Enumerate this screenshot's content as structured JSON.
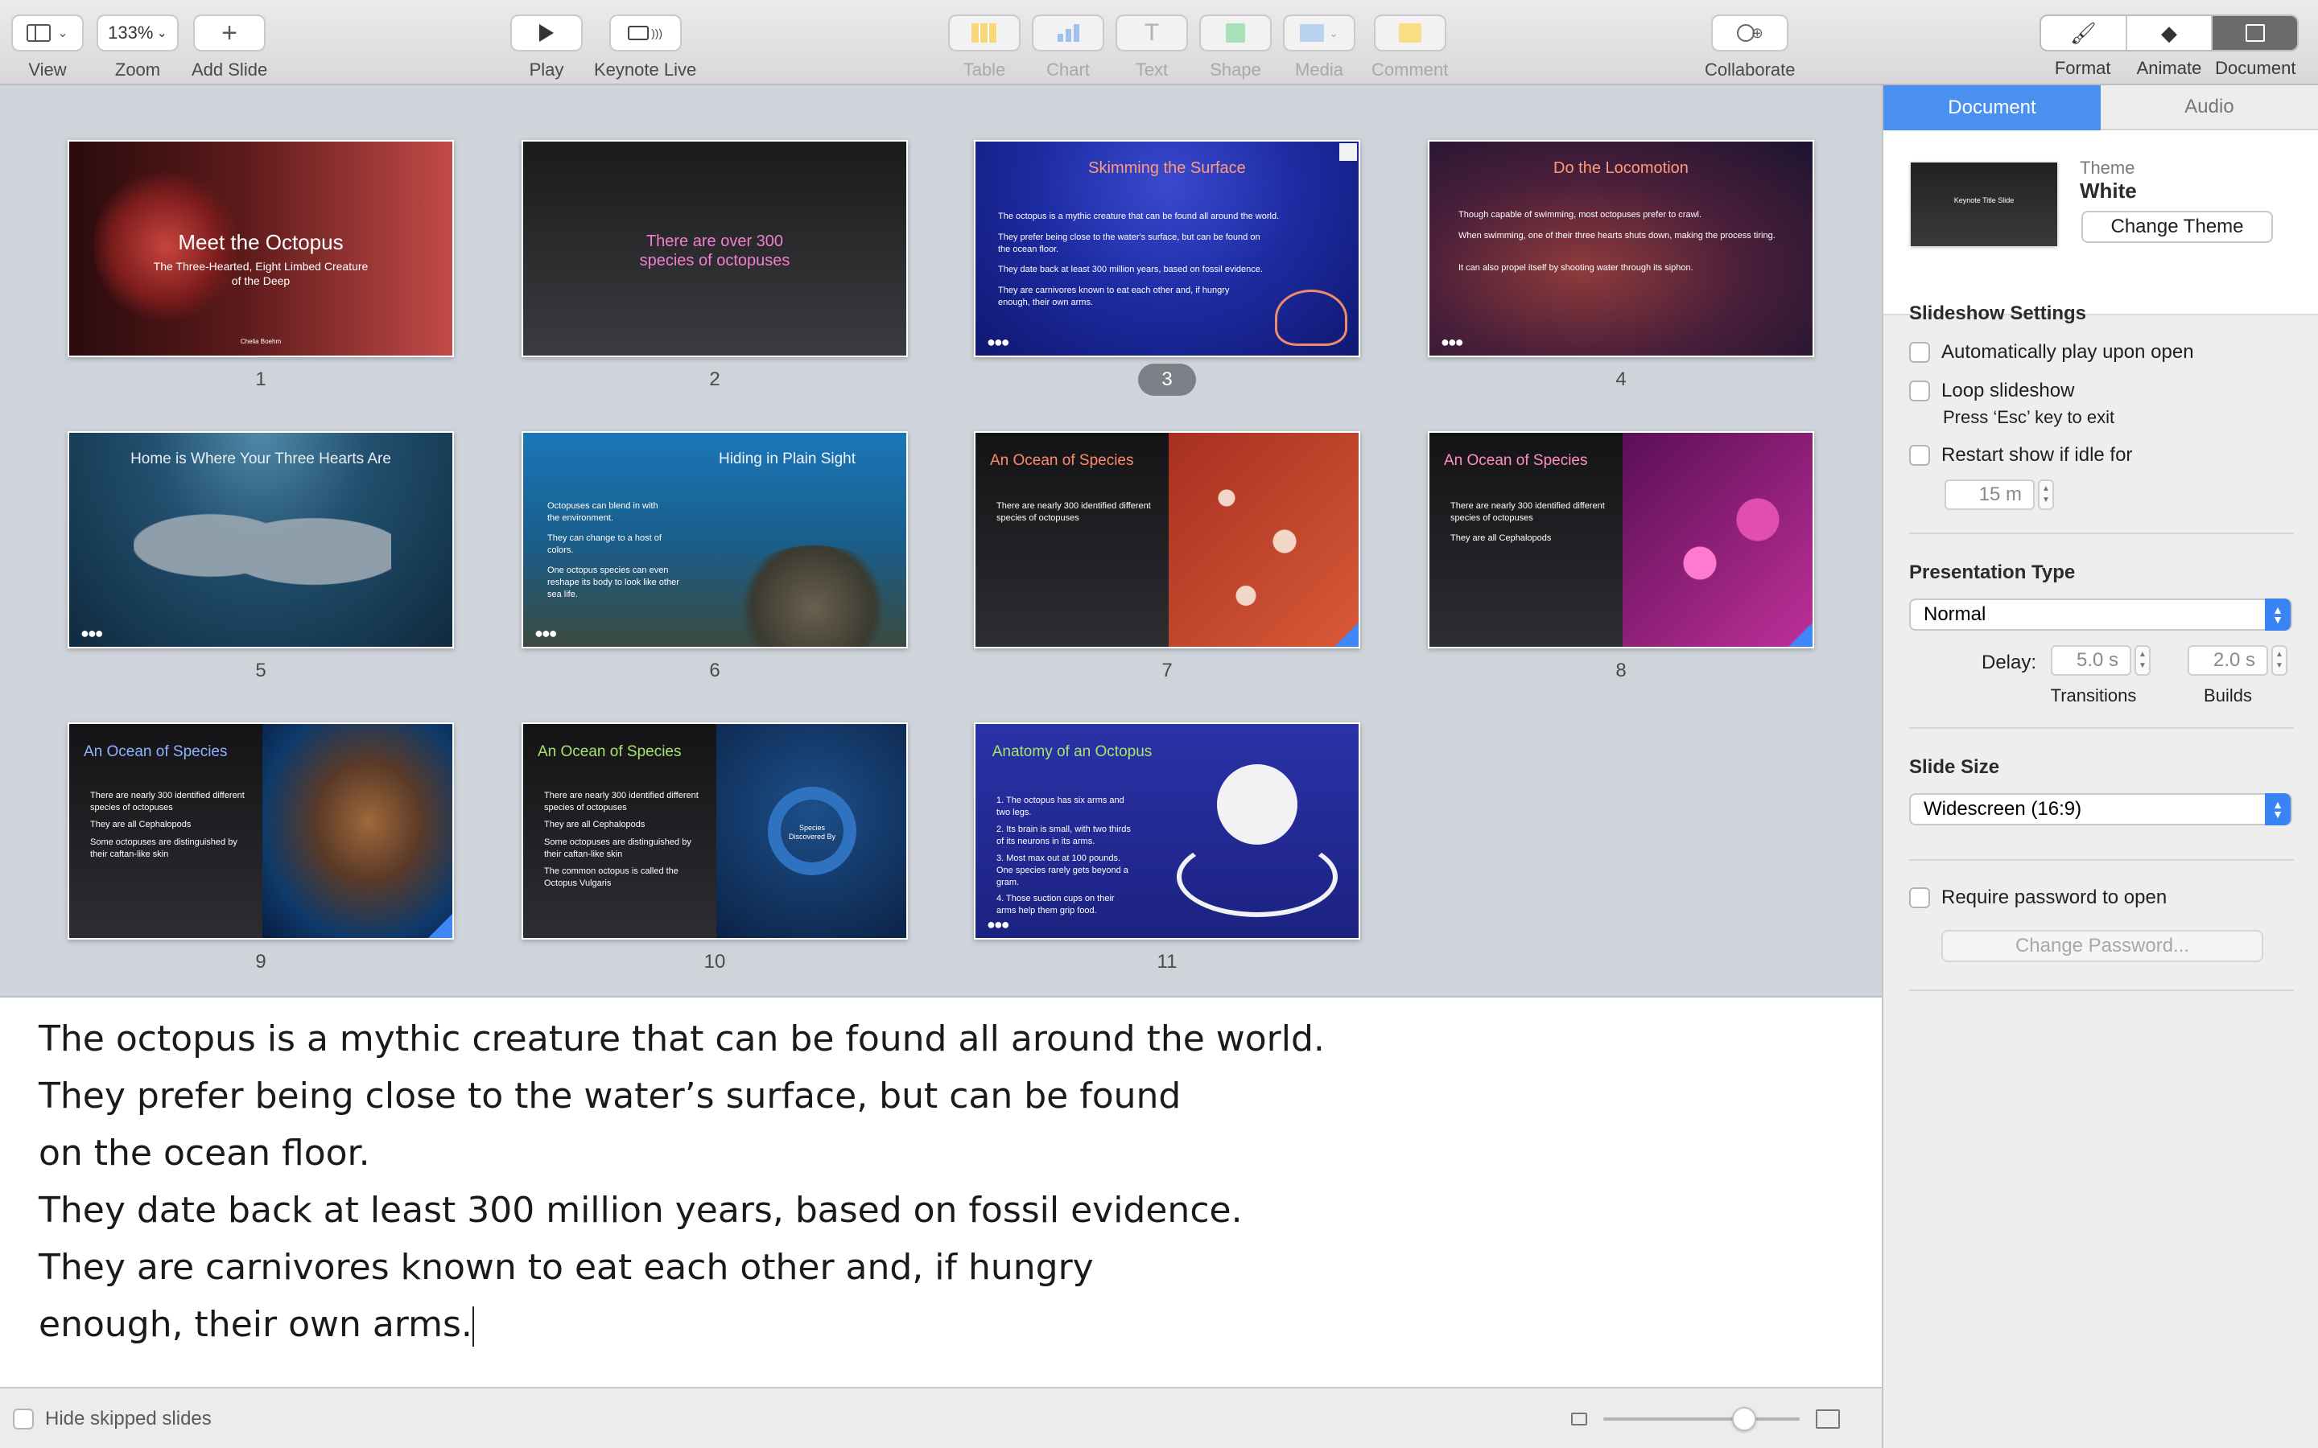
{
  "toolbar": {
    "view_label": "View",
    "zoom_value": "133%",
    "zoom_label": "Zoom",
    "add_slide_label": "Add Slide",
    "play_label": "Play",
    "keynote_live_label": "Keynote Live",
    "table_label": "Table",
    "chart_label": "Chart",
    "text_label": "Text",
    "shape_label": "Shape",
    "media_label": "Media",
    "comment_label": "Comment",
    "collaborate_label": "Collaborate",
    "format_label": "Format",
    "animate_label": "Animate",
    "document_label": "Document"
  },
  "slides": [
    {
      "num": "1",
      "title": "Meet the Octopus",
      "subtitle": "The Three-Hearted, Eight Limbed Creature of the Deep",
      "author": "Chelia Boehm"
    },
    {
      "num": "2",
      "title": "There are over 300 species of octopuses"
    },
    {
      "num": "3",
      "title": "Skimming the Surface",
      "bullets": [
        "The octopus is a mythic creature that can be found all around the world.",
        "They prefer being close to the water's surface, but can be found on the ocean floor.",
        "They date back at least 300 million years, based on fossil evidence.",
        "They are carnivores known to eat each other and, if hungry enough, their own arms."
      ]
    },
    {
      "num": "4",
      "title": "Do the Locomotion",
      "bullets": [
        "Though capable of swimming, most octopuses prefer to crawl.",
        "When swimming, one of their three hearts shuts down, making the process tiring.",
        "It can also propel itself by shooting water through its siphon."
      ]
    },
    {
      "num": "5",
      "title": "Home is Where Your Three Hearts Are"
    },
    {
      "num": "6",
      "title": "Hiding in Plain Sight",
      "bullets": [
        "Octopuses can blend in with the environment.",
        "They can change to a host of colors.",
        "One octopus species can even reshape its body to look like other sea life."
      ]
    },
    {
      "num": "7",
      "title": "An Ocean of Species",
      "bullets": [
        "There are nearly 300 identified different species of octopuses"
      ]
    },
    {
      "num": "8",
      "title": "An Ocean of Species",
      "bullets": [
        "There are nearly 300 identified different species of octopuses",
        "They are all Cephalopods"
      ]
    },
    {
      "num": "9",
      "title": "An Ocean of Species",
      "bullets": [
        "There are nearly 300 identified different species of octopuses",
        "They are all Cephalopods",
        "Some octopuses are distinguished by their caftan-like skin"
      ]
    },
    {
      "num": "10",
      "title": "An Ocean of Species",
      "bullets": [
        "There are nearly 300 identified different species of octopuses",
        "They are all Cephalopods",
        "Some octopuses are distinguished by their caftan-like skin",
        "The common octopus is called the Octopus Vulgaris"
      ],
      "chart_center": "Species Discovered By"
    },
    {
      "num": "11",
      "title": "Anatomy of an Octopus",
      "bullets": [
        "1. The octopus has six arms and two legs.",
        "2. Its brain is small, with two thirds of its neurons in its arms.",
        "3. Most max out at 100 pounds. One species rarely gets beyond a gram.",
        "4. Those suction cups on their arms help them grip food."
      ]
    }
  ],
  "notes": [
    "The octopus is a mythic creature that can be found all around the world.",
    "They prefer being close to the water’s surface, but can be found",
    "on the ocean floor.",
    "They date back at least 300 million years, based on fossil evidence.",
    "They are carnivores known to eat each other and, if hungry",
    "enough, their own arms."
  ],
  "bottombar": {
    "hide_skipped_label": "Hide skipped slides"
  },
  "inspector": {
    "tab_document": "Document",
    "tab_audio": "Audio",
    "theme_caption": "Theme",
    "theme_name": "White",
    "theme_thumb_title": "Keynote Title Slide",
    "change_theme_label": "Change Theme",
    "slideshow_settings_title": "Slideshow Settings",
    "auto_play_label": "Automatically play upon open",
    "loop_label": "Loop slideshow",
    "loop_hint": "Press ‘Esc’ key to exit",
    "restart_label": "Restart show if idle for",
    "idle_value": "15 m",
    "presentation_type_title": "Presentation Type",
    "presentation_type_value": "Normal",
    "delay_label": "Delay:",
    "transitions_value": "5.0 s",
    "builds_value": "2.0 s",
    "transitions_label": "Transitions",
    "builds_label": "Builds",
    "slide_size_title": "Slide Size",
    "slide_size_value": "Widescreen (16:9)",
    "require_password_label": "Require password to open",
    "change_password_label": "Change Password..."
  }
}
